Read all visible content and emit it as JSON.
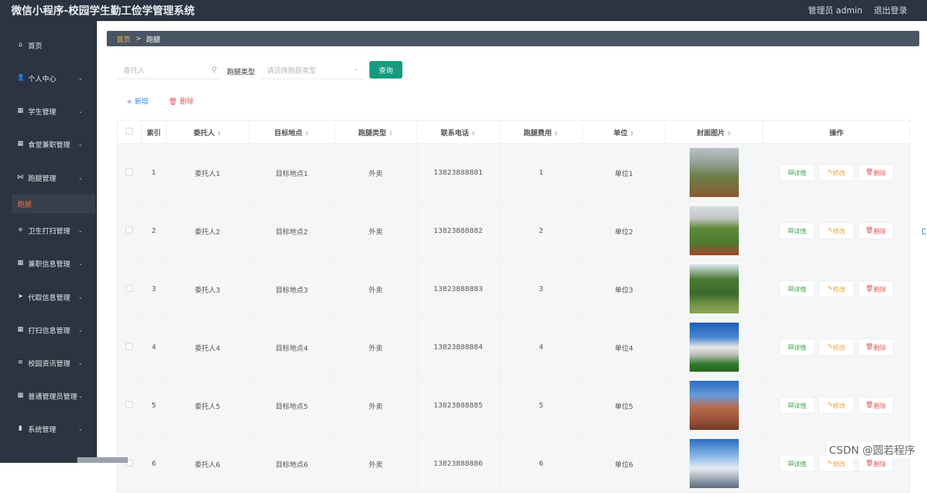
{
  "app": {
    "title": "微信小程序-校园学生勤工俭学管理系统",
    "user_label": "管理员 admin",
    "logout_label": "退出登录"
  },
  "sidebar": {
    "items": [
      {
        "label": "首页",
        "icon": "home-icon",
        "glyph": "⌂",
        "chevron": false
      },
      {
        "label": "个人中心",
        "icon": "user-icon",
        "glyph": "👤",
        "chevron": true
      },
      {
        "label": "学生管理",
        "icon": "grid-icon",
        "glyph": "▦",
        "chevron": true
      },
      {
        "label": "食堂兼职管理",
        "icon": "grid-icon",
        "glyph": "▦",
        "chevron": true
      },
      {
        "label": "跑腿管理",
        "icon": "bowtie-icon",
        "glyph": "⋈",
        "chevron": true
      },
      {
        "label": "卫生打扫管理",
        "icon": "sliders-icon",
        "glyph": "≑",
        "chevron": true
      },
      {
        "label": "兼职信息管理",
        "icon": "grid-icon",
        "glyph": "▦",
        "chevron": true
      },
      {
        "label": "代取信息管理",
        "icon": "send-icon",
        "glyph": "➤",
        "chevron": true
      },
      {
        "label": "打扫信息管理",
        "icon": "grid-icon",
        "glyph": "▦",
        "chevron": true
      },
      {
        "label": "校园资讯管理",
        "icon": "list-icon",
        "glyph": "≡",
        "chevron": true
      },
      {
        "label": "普通管理员管理",
        "icon": "grid-icon",
        "glyph": "▦",
        "chevron": true
      },
      {
        "label": "系统管理",
        "icon": "chart-icon",
        "glyph": "▮",
        "chevron": true
      }
    ],
    "active_submenu": "跑腿"
  },
  "breadcrumb": {
    "home": "首页",
    "separator": ">",
    "current": "跑腿"
  },
  "search": {
    "placeholder": "委托人",
    "type_label": "跑腿类型",
    "type_placeholder": "请选择跑腿类型",
    "query_button": "查询"
  },
  "actions": {
    "add": "+ 新增",
    "delete": "🗑 删除"
  },
  "table": {
    "columns": [
      "",
      "索引",
      "委托人",
      "目标地点",
      "跑腿类型",
      "联系电话",
      "跑腿费用",
      "单位",
      "封面图片",
      "操作"
    ],
    "row_buttons": {
      "detail": "详情",
      "edit": "修改",
      "delete": "删除"
    },
    "rows": [
      {
        "index": "1",
        "client": "委托人1",
        "target": "目标地点1",
        "type": "外卖",
        "phone": "13823888881",
        "fee": "1",
        "unit": "单位1"
      },
      {
        "index": "2",
        "client": "委托人2",
        "target": "目标地点2",
        "type": "外卖",
        "phone": "13823888882",
        "fee": "2",
        "unit": "单位2"
      },
      {
        "index": "3",
        "client": "委托人3",
        "target": "目标地点3",
        "type": "外卖",
        "phone": "13823888883",
        "fee": "3",
        "unit": "单位3"
      },
      {
        "index": "4",
        "client": "委托人4",
        "target": "目标地点4",
        "type": "外卖",
        "phone": "13823888884",
        "fee": "4",
        "unit": "单位4"
      },
      {
        "index": "5",
        "client": "委托人5",
        "target": "目标地点5",
        "type": "外卖",
        "phone": "13823888885",
        "fee": "5",
        "unit": "单位5"
      },
      {
        "index": "6",
        "client": "委托人6",
        "target": "目标地点6",
        "type": "外卖",
        "phone": "13823888886",
        "fee": "6",
        "unit": "单位6"
      }
    ]
  },
  "watermark": "CSDN @圆若程序",
  "colors": {
    "sidebar_bg": "#2b3440",
    "breadcrumb_bg": "#4a5563",
    "query_button": "#169b81",
    "active_menu_text": "#ff6a3d",
    "detail_green": "#3aa74a",
    "edit_orange": "#f0a23a",
    "delete_red": "#e25b5b",
    "add_blue": "#3a8ee6"
  }
}
